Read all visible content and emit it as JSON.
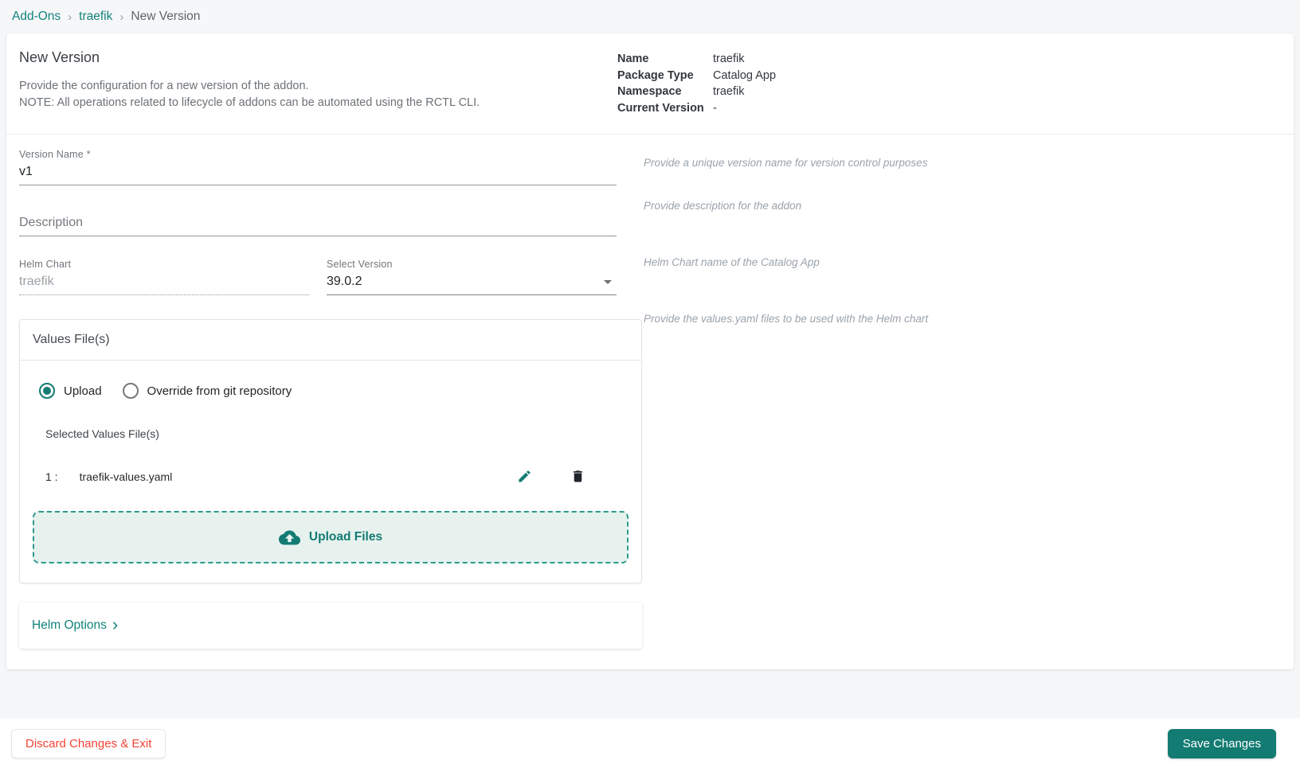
{
  "colors": {
    "accent": "#137b72",
    "link": "#13837c",
    "danger": "#f44336",
    "dropzone_bg": "#e7f2ef",
    "page_bg": "#f6f7f9"
  },
  "breadcrumb": {
    "separator": "›",
    "items": [
      {
        "label": "Add-Ons",
        "link": true
      },
      {
        "label": "traefik",
        "link": true
      },
      {
        "label": "New Version",
        "link": false
      }
    ]
  },
  "header": {
    "title": "New Version",
    "description_lines": [
      "Provide the configuration for a new version of the addon.",
      "NOTE: All operations related to lifecycle of addons can be automated using the RCTL CLI."
    ],
    "info": [
      {
        "label": "Name",
        "value": "traefik"
      },
      {
        "label": "Package Type",
        "value": "Catalog App"
      },
      {
        "label": "Namespace",
        "value": "traefik"
      },
      {
        "label": "Current Version",
        "value": "-"
      }
    ]
  },
  "form": {
    "version_name": {
      "label": "Version Name *",
      "value": "v1",
      "helper": "Provide a unique version name for version control purposes"
    },
    "description": {
      "placeholder": "Description",
      "helper": "Provide description for the addon"
    },
    "helm_chart": {
      "label": "Helm Chart",
      "value": "traefik"
    },
    "select_version": {
      "label": "Select Version",
      "value": "39.0.2",
      "helper": "Helm Chart name of the Catalog App"
    },
    "values_files": {
      "title": "Values File(s)",
      "helper": "Provide the values.yaml files to be used with the Helm chart",
      "radio_options": [
        {
          "label": "Upload",
          "selected": true
        },
        {
          "label": "Override from git repository",
          "selected": false
        }
      ],
      "selected_files_label": "Selected Values File(s)",
      "files": [
        {
          "index": "1 :",
          "name": "traefik-values.yaml"
        }
      ],
      "upload_button_label": "Upload Files",
      "icons": [
        "edit-pencil-icon",
        "delete-trash-icon",
        "cloud-upload-icon"
      ]
    },
    "helm_options": {
      "label": "Helm Options",
      "chevron": "›"
    }
  },
  "footer": {
    "discard_label": "Discard Changes & Exit",
    "save_label": "Save Changes"
  }
}
